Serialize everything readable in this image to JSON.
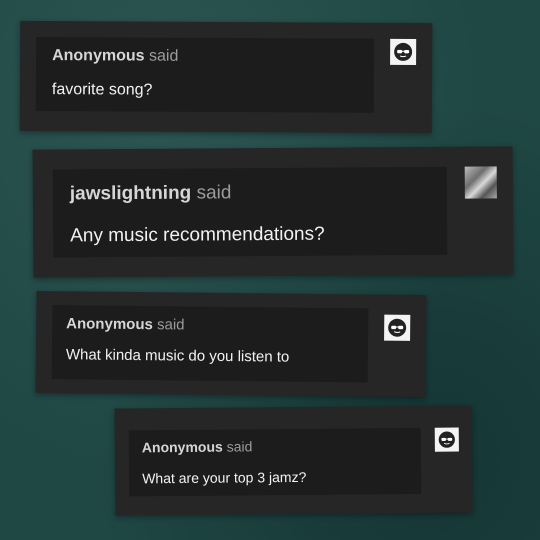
{
  "asks": [
    {
      "asker": "Anonymous",
      "said": "said",
      "message": "favorite song?",
      "avatar_icon": "anon-sunglasses-icon"
    },
    {
      "asker": "jawslightning",
      "said": "said",
      "message": "Any music recommendations?",
      "avatar_icon": "user-avatar-image"
    },
    {
      "asker": "Anonymous",
      "said": "said",
      "message": "What kinda music do you listen to",
      "avatar_icon": "anon-sunglasses-icon"
    },
    {
      "asker": "Anonymous",
      "said": "said",
      "message": "What are your top 3 jamz?",
      "avatar_icon": "anon-sunglasses-icon"
    }
  ],
  "colors": {
    "background": "#1f4744",
    "card": "#262626",
    "inner": "#1c1c1c",
    "text": "#f2f2f2",
    "asker": "#d6d6d6",
    "said": "#9c9c9c"
  }
}
